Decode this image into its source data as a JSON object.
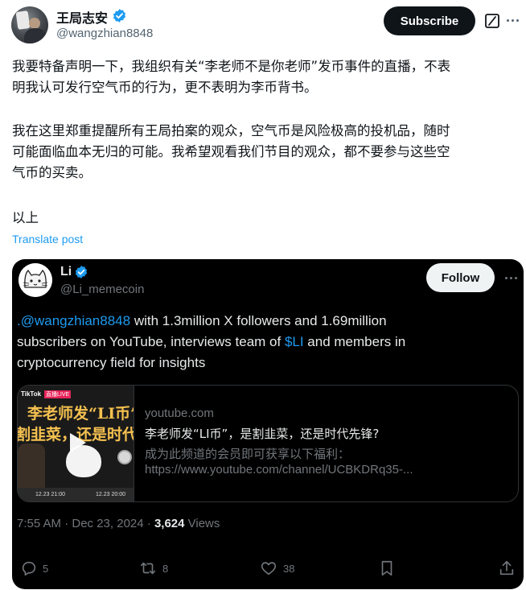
{
  "tweet": {
    "author_name": "王局志安",
    "handle": "@wangzhian8848",
    "subscribe_label": "Subscribe",
    "paragraph1_line1": "我要特备声明一下，我组织有关“李老师不是你老师”发币事件的直播，不表",
    "paragraph1_line2": "明我认可发行空气币的行为，更不表明为李币背书。",
    "paragraph2_line1": "我在这里郑重提醒所有王局拍案的观众，空气币是风险极高的投机品，随时",
    "paragraph2_line2": "可能面临血本无归的可能。我希望观看我们节目的观众，都不要参与这些空",
    "paragraph2_line3": "气币的买卖。",
    "paragraph3": "以上",
    "translate_label": "Translate post",
    "icons": {
      "verified": "verified-badge-icon",
      "grok": "grok-icon",
      "more": "more-icon"
    },
    "colors": {
      "link": "#1d9bf0",
      "verified": "#1d9bf0",
      "subscribe_bg": "#0f1419"
    }
  },
  "quote": {
    "author_name": "Li",
    "handle": "@Li_memecoin",
    "follow_label": "Follow",
    "text": {
      "line1_mention": ".@wangzhian8848",
      "line1_rest": " with 1.3million X followers and 1.69million",
      "line2_pre": "subscribers on YouTube, interviews team of ",
      "line2_cashtag": "$LI",
      "line2_post": " and members in",
      "line3": "cryptocurrency field for insights"
    },
    "card": {
      "domain": "youtube.com",
      "title": "李老师发“LI币”，是割韭菜，还是时代先锋?",
      "description_line1": "成为此频道的会员即可获享以下福利：",
      "description_line2": "https://www.youtube.com/channel/UCBKDRq35-...",
      "thumbnail": {
        "app_label": "TikTok",
        "live_badge": "直播LIVE",
        "line1": "李老师发“LI币”，",
        "line2": "割韭菜，还是时代先锋",
        "time_left": "12.23 21:00",
        "time_right": "12.23 20:00"
      }
    },
    "meta": {
      "time_date": "7:55 AM · Dec 23, 2024 · ",
      "views_count": "3,624",
      "views_label": " Views"
    },
    "actions": {
      "replies": "5",
      "reposts": "8",
      "likes": "38"
    }
  }
}
